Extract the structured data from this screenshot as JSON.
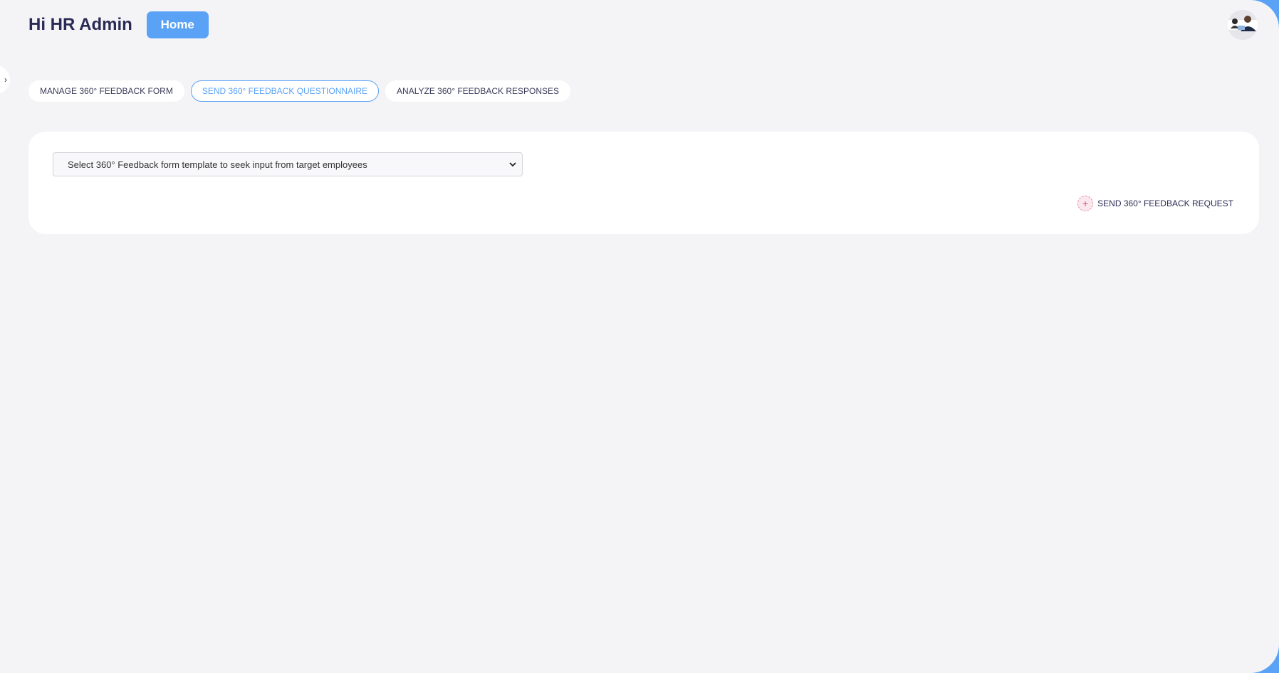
{
  "header": {
    "greeting": "Hi HR Admin",
    "home_label": "Home"
  },
  "sidebar_toggle": {
    "glyph": "›"
  },
  "tabs": [
    {
      "label": "MANAGE 360° FEEDBACK FORM",
      "active": false
    },
    {
      "label": "SEND 360° FEEDBACK QUESTIONNAIRE",
      "active": true
    },
    {
      "label": "ANALYZE 360° FEEDBACK RESPONSES",
      "active": false
    }
  ],
  "form": {
    "template_select_value": "Select 360° Feedback form template to seek input from target employees",
    "send_request_label": "SEND 360° FEEDBACK REQUEST",
    "send_request_icon": "plus-circle-icon"
  },
  "colors": {
    "accent": "#5aa2f5",
    "title": "#2b2a55",
    "background": "#f4f4f7"
  }
}
